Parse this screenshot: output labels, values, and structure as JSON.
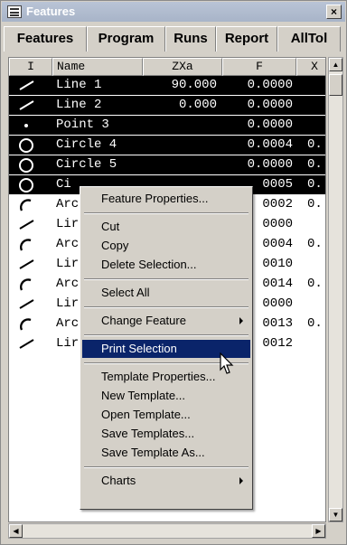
{
  "window": {
    "title": "Features",
    "close_glyph": "×"
  },
  "tabs": [
    "Features",
    "Program",
    "Runs",
    "Report",
    "AllTol"
  ],
  "table": {
    "columns": [
      "I",
      "Name",
      "ZXa",
      "F",
      "X"
    ],
    "rows": [
      {
        "icon": "line-icon",
        "name": "Line 1",
        "zxa": "90.000",
        "f": "0.0000",
        "x": "",
        "selected": true
      },
      {
        "icon": "line-icon",
        "name": "Line 2",
        "zxa": "0.000",
        "f": "0.0000",
        "x": "",
        "selected": true
      },
      {
        "icon": "point-icon",
        "name": "Point 3",
        "zxa": "",
        "f": "0.0000",
        "x": "",
        "selected": true
      },
      {
        "icon": "circle-icon",
        "name": "Circle 4",
        "zxa": "",
        "f": "0.0004",
        "x": "0.",
        "selected": true
      },
      {
        "icon": "circle-icon",
        "name": "Circle 5",
        "zxa": "",
        "f": "0.0000",
        "x": "0.",
        "selected": true
      },
      {
        "icon": "circle-icon",
        "name": "Ci",
        "zxa": "",
        "f": "0005",
        "x": "0.",
        "selected": true
      },
      {
        "icon": "arc-icon",
        "name": "Arc",
        "zxa": "",
        "f": "0002",
        "x": "0.",
        "selected": false
      },
      {
        "icon": "line-icon",
        "name": "Lir",
        "zxa": "",
        "f": "0000",
        "x": "",
        "selected": false
      },
      {
        "icon": "arc-icon",
        "name": "Arc",
        "zxa": "",
        "f": "0004",
        "x": "0.",
        "selected": false
      },
      {
        "icon": "line-icon",
        "name": "Lir",
        "zxa": "",
        "f": "0010",
        "x": "",
        "selected": false
      },
      {
        "icon": "arc-icon",
        "name": "Arc",
        "zxa": "",
        "f": "0014",
        "x": "0.",
        "selected": false
      },
      {
        "icon": "line-icon",
        "name": "Lir",
        "zxa": "",
        "f": "0000",
        "x": "",
        "selected": false
      },
      {
        "icon": "arc-icon",
        "name": "Arc",
        "zxa": "",
        "f": "0013",
        "x": "0.",
        "selected": false
      },
      {
        "icon": "line-icon",
        "name": "Lir",
        "zxa": "",
        "f": "0012",
        "x": "",
        "selected": false
      }
    ]
  },
  "context_menu": {
    "items": [
      {
        "label": "Feature Properties...",
        "group": 0
      },
      {
        "label": "Cut",
        "group": 1
      },
      {
        "label": "Copy",
        "group": 1
      },
      {
        "label": "Delete Selection...",
        "group": 1
      },
      {
        "label": "Select All",
        "group": 2
      },
      {
        "label": "Change Feature",
        "group": 3,
        "submenu": true
      },
      {
        "label": "Print Selection",
        "group": 4,
        "highlighted": true
      },
      {
        "label": "Template Properties...",
        "group": 5
      },
      {
        "label": "New Template...",
        "group": 5
      },
      {
        "label": "Open Template...",
        "group": 5
      },
      {
        "label": "Save Templates...",
        "group": 5
      },
      {
        "label": "Save Template As...",
        "group": 5
      },
      {
        "label": "Charts",
        "group": 6,
        "submenu": true
      }
    ]
  },
  "colors": {
    "selection_bg": "#000000",
    "menu_highlight": "#0a246a",
    "titlebar": "#a8b4c8"
  }
}
